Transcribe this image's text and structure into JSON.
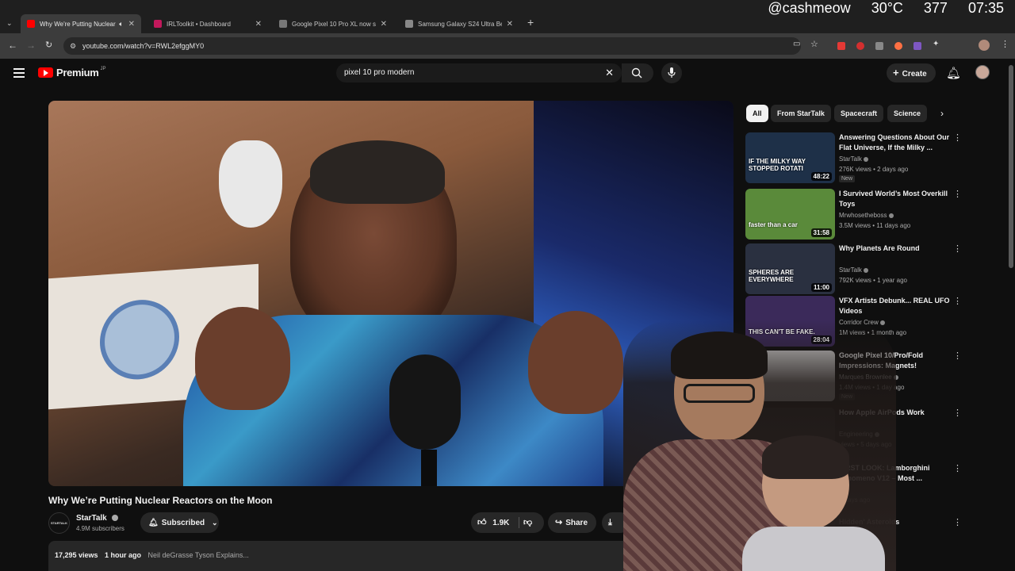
{
  "browser": {
    "tabs": [
      {
        "title": "Why We're Putting Nuclear",
        "active": true,
        "color": "#ff0000"
      },
      {
        "title": "IRLToolkit • Dashboard",
        "active": false,
        "color": "#c2185b"
      },
      {
        "title": "Google Pixel 10 Pro XL now sp",
        "active": false,
        "color": "#777777"
      },
      {
        "title": "Samsung Galaxy S24 Ultra Benc",
        "active": false,
        "color": "#888888"
      }
    ],
    "url": "youtube.com/watch?v=RWL2efggMY0"
  },
  "stream_overlay": {
    "handle": "@cashmeow",
    "temp": "30°C",
    "count": "377",
    "time": "07:35"
  },
  "youtube": {
    "logo_text": "Premium",
    "logo_sup": "JP",
    "search_value": "pixel 10 pro modern",
    "create_label": "Create"
  },
  "video": {
    "title": "Why We’re Putting Nuclear Reactors on the Moon",
    "channel": "StarTalk",
    "channel_avatar_text": "STARTALK",
    "subscribers": "4.9M subscribers",
    "subscribed_label": "Subscribed",
    "likes": "1.9K",
    "share_label": "Share",
    "views": "17,295 views",
    "age": "1 hour ago",
    "description": "Neil deGrasse Tyson Explains..."
  },
  "chips": [
    "All",
    "From StarTalk",
    "Spacecraft",
    "Science"
  ],
  "recommendations": [
    {
      "title": "Answering Questions About Our Flat Universe, If the Milky ...",
      "channel": "StarTalk",
      "meta": "276K views • 2 days ago",
      "duration": "48:22",
      "badge": "New",
      "thumb_text": "IF THE MILKY WAY STOPPED ROTATI",
      "thumb_color": "#1e3048"
    },
    {
      "title": "I Survived World’s Most Overkill Toys",
      "channel": "Mrwhosetheboss",
      "meta": "3.5M views • 11 days ago",
      "duration": "31:58",
      "badge": "",
      "thumb_text": "faster than a car",
      "thumb_color": "#5a8a3a"
    },
    {
      "title": "Why Planets Are Round",
      "channel": "StarTalk",
      "meta": "792K views • 1 year ago",
      "duration": "11:00",
      "badge": "",
      "thumb_text": "SPHERES ARE EVERYWHERE",
      "thumb_color": "#2a3040"
    },
    {
      "title": "VFX Artists Debunk... REAL UFO Videos",
      "channel": "Corridor Crew",
      "meta": "1M views • 1 month ago",
      "duration": "28:04",
      "badge": "",
      "thumb_text": "THIS CAN'T BE FAKE.",
      "thumb_color": "#3b2a5a"
    },
    {
      "title": "Google Pixel 10/Pro/Fold Impressions: Magnets!",
      "channel": "Marques Brownlee",
      "meta": "1.4M views • 1 day ago",
      "duration": "",
      "badge": "New",
      "thumb_text": "",
      "thumb_color": "#d8d8d8"
    },
    {
      "title": "How Apple AirPods Work",
      "channel": "Engineering",
      "meta": "views • 5 days ago",
      "duration": "",
      "badge": "",
      "thumb_text": "",
      "thumb_color": "#222222"
    },
    {
      "title": "FIRST LOOK: Lamborghini Fenomeno V12 – Most ...",
      "channel": "",
      "meta": "6 days ago",
      "duration": "",
      "badge": "",
      "thumb_text": "",
      "thumb_color": "#222222"
    },
    {
      "title": "Hidden' Asteroids",
      "channel": "",
      "meta": "",
      "duration": "",
      "badge": "",
      "thumb_text": "",
      "thumb_color": "#222222"
    }
  ]
}
